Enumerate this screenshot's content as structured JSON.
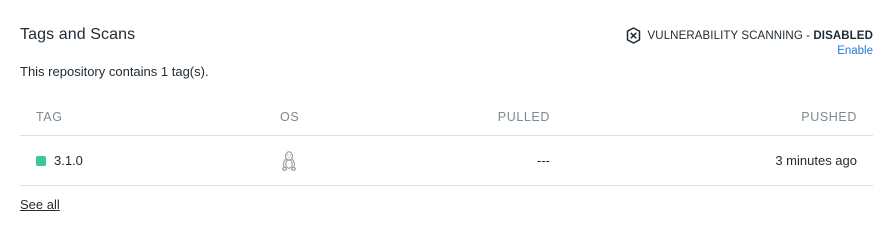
{
  "header": {
    "title": "Tags and Scans",
    "subtitle": "This repository contains 1 tag(s)."
  },
  "vulnerability": {
    "icon": "shield-x-icon",
    "label": "VULNERABILITY SCANNING - ",
    "status": "DISABLED",
    "enable_link": "Enable"
  },
  "table": {
    "columns": {
      "tag": "TAG",
      "os": "OS",
      "pulled": "PULLED",
      "pushed": "PUSHED"
    },
    "rows": [
      {
        "tag": "3.1.0",
        "os_icon": "linux-icon",
        "pulled": "---",
        "pushed": "3 minutes ago"
      }
    ]
  },
  "footer": {
    "see_all": "See all"
  },
  "colors": {
    "status_dot": "#3bc6a0",
    "link": "#1f7bd8",
    "border": "#d9dfe3",
    "muted_header": "#7d8a93"
  }
}
